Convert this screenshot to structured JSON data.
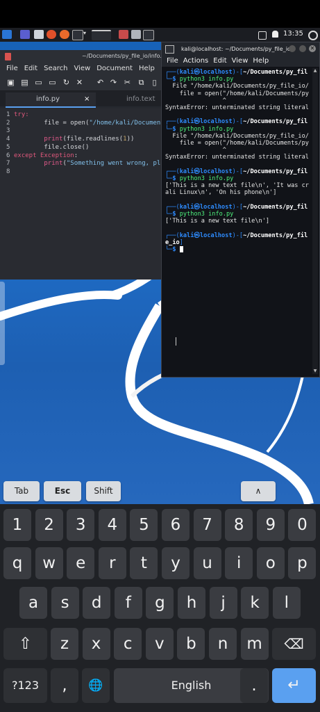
{
  "taskbar": {
    "time": "13:35",
    "icons": [
      "kali-menu-icon",
      "desktop-icon",
      "files-icon",
      "firefox-icon",
      "terminal-icon",
      "chevron-icon",
      "window-icon",
      "python-icon",
      "folder-icon",
      "terminal-icon",
      "editor-icon"
    ]
  },
  "editor": {
    "title": "~/Documents/py_file_io/info.py",
    "menu": [
      "File",
      "Edit",
      "Search",
      "View",
      "Document",
      "Help"
    ],
    "tabs": [
      {
        "label": "info.py",
        "close": "×"
      },
      {
        "label": "info.text"
      }
    ],
    "code_lines": [
      {
        "n": "1",
        "text": "try:"
      },
      {
        "n": "2",
        "text": "        file = open(\"/home/kali/Documents/"
      },
      {
        "n": "3",
        "text": ""
      },
      {
        "n": "4",
        "text": "        print(file.readlines(1))"
      },
      {
        "n": "5",
        "text": "        file.close()"
      },
      {
        "n": "6",
        "text": "except Exception:"
      },
      {
        "n": "7",
        "text": "        print(\"Something went wrong, pleas"
      },
      {
        "n": "8",
        "text": ""
      }
    ]
  },
  "terminal": {
    "title": "kali@localhost: ~/Documents/py_file_io",
    "menu": [
      "File",
      "Actions",
      "Edit",
      "View",
      "Help"
    ],
    "lines": [
      {
        "type": "prompt",
        "user": "kali",
        "host": "localhost",
        "path": "~/Documents/py_fil"
      },
      {
        "type": "cmd",
        "text": "python3 info.py"
      },
      {
        "type": "out",
        "text": "  File \"/home/kali/Documents/py_file_io/"
      },
      {
        "type": "out",
        "text": "    file = open(\"/home/kali/Documents/py"
      },
      {
        "type": "out",
        "text": "                ^"
      },
      {
        "type": "out",
        "text": "SyntaxError: unterminated string literal"
      },
      {
        "type": "blank",
        "text": ""
      },
      {
        "type": "prompt",
        "user": "kali",
        "host": "localhost",
        "path": "~/Documents/py_fil"
      },
      {
        "type": "cmd",
        "text": "python3 info.py"
      },
      {
        "type": "out",
        "text": "  File \"/home/kali/Documents/py_file_io/"
      },
      {
        "type": "out",
        "text": "    file = open(\"/home/kali/Documents/py"
      },
      {
        "type": "out",
        "text": "                ^"
      },
      {
        "type": "out",
        "text": "SyntaxError: unterminated string literal"
      },
      {
        "type": "blank",
        "text": ""
      },
      {
        "type": "prompt",
        "user": "kali",
        "host": "localhost",
        "path": "~/Documents/py_fil"
      },
      {
        "type": "cmd",
        "text": "python3 info.py"
      },
      {
        "type": "out",
        "text": "['This is a new text file\\n', 'It was cr"
      },
      {
        "type": "out",
        "text": "ali Linux\\n', 'On his phone\\n']"
      },
      {
        "type": "blank",
        "text": ""
      },
      {
        "type": "prompt",
        "user": "kali",
        "host": "localhost",
        "path": "~/Documents/py_fil"
      },
      {
        "type": "cmd",
        "text": "python3 info.py"
      },
      {
        "type": "out",
        "text": "['This is a new text file\\n']"
      },
      {
        "type": "blank",
        "text": ""
      },
      {
        "type": "prompt",
        "user": "kali",
        "host": "localhost",
        "path": "~/Documents/py_fil"
      },
      {
        "type": "out2",
        "text": "e_io]"
      },
      {
        "type": "cursor",
        "text": ""
      }
    ]
  },
  "extra_keys": [
    "Tab",
    "Esc",
    "Shift",
    "∧"
  ],
  "keyboard": {
    "row1": [
      "1",
      "2",
      "3",
      "4",
      "5",
      "6",
      "7",
      "8",
      "9",
      "0"
    ],
    "row2": [
      "q",
      "w",
      "e",
      "r",
      "t",
      "y",
      "u",
      "i",
      "o",
      "p"
    ],
    "row3": [
      "a",
      "s",
      "d",
      "f",
      "g",
      "h",
      "j",
      "k",
      "l"
    ],
    "row4": [
      "z",
      "x",
      "c",
      "v",
      "b",
      "n",
      "m"
    ],
    "symbols": "?123",
    "comma": ",",
    "space": "English",
    "period": "."
  },
  "colors": {
    "accent": "#5aa0f0",
    "terminal_prompt": "#2e8cff",
    "terminal_cmd": "#4ef07c"
  }
}
